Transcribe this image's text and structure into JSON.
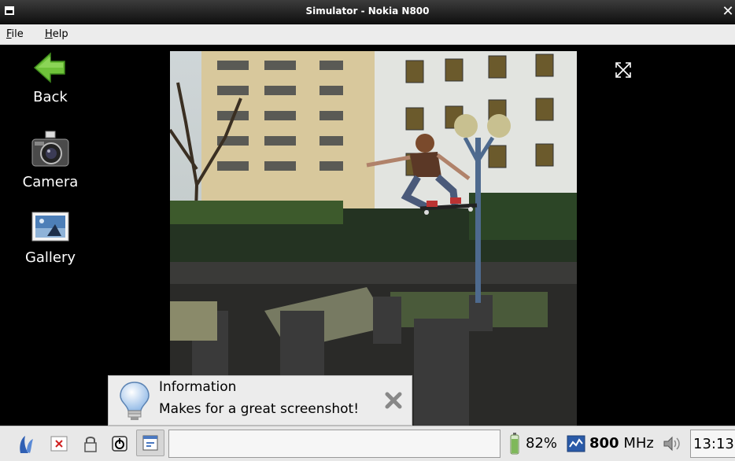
{
  "window": {
    "title": "Simulator - Nokia N800",
    "close_glyph": "✕"
  },
  "menubar": {
    "items": [
      {
        "mnemonic": "F",
        "rest": "ile"
      },
      {
        "mnemonic": "H",
        "rest": "elp"
      }
    ]
  },
  "desktop": {
    "shortcuts": [
      {
        "label": "Back",
        "icon": "back-arrow-icon"
      },
      {
        "label": "Camera",
        "icon": "camera-icon"
      },
      {
        "label": "Gallery",
        "icon": "gallery-icon"
      }
    ]
  },
  "banner": {
    "title": "Information",
    "message": "Makes for a great screenshot!",
    "icon": "lightbulb-icon"
  },
  "taskbar": {
    "battery_percent": "82%",
    "cpu_value": "800",
    "cpu_unit": "MHz",
    "clock": "13:13",
    "battery_level": 0.82
  },
  "colors": {
    "back_arrow": "#6fc23a",
    "titlebar": "#1a1a1a",
    "menubar": "#ececec",
    "taskbar": "#e8e8e8"
  }
}
